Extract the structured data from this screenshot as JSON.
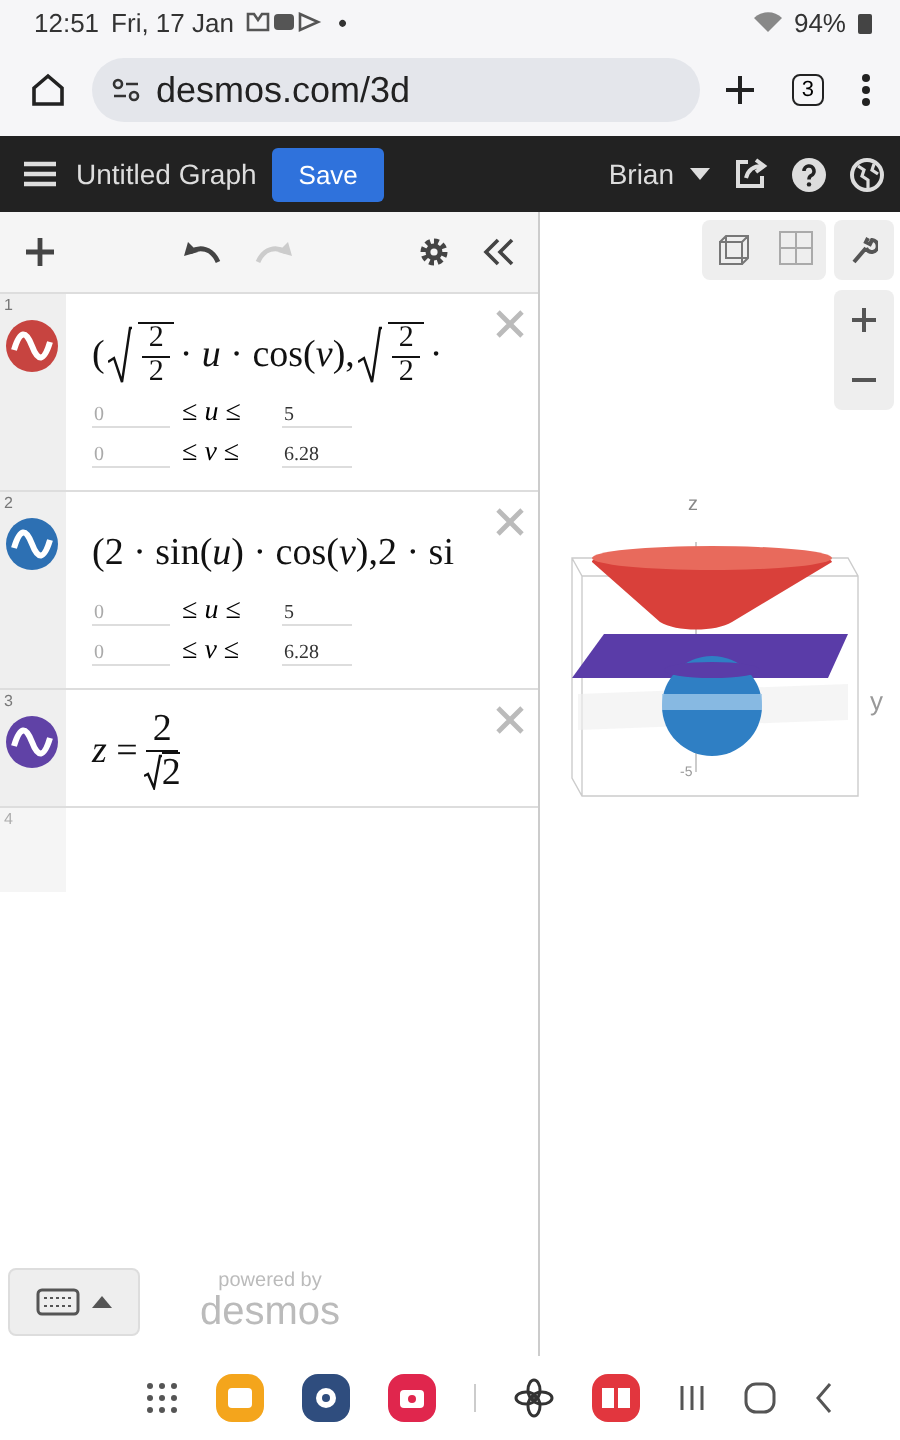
{
  "status_bar": {
    "time": "12:51",
    "date": "Fri, 17 Jan",
    "dot": "•",
    "battery": "94%"
  },
  "browser": {
    "url": "desmos.com/3d",
    "tab_count": "3"
  },
  "header": {
    "title": "Untitled Graph",
    "save": "Save",
    "user": "Brian"
  },
  "expressions": [
    {
      "number": "1",
      "color": "#c74440",
      "parts": [
        {
          "kind": "text",
          "text": "("
        },
        {
          "kind": "sqrtfrac",
          "num": "2",
          "den": "2"
        },
        {
          "kind": "text",
          "text": " · *u* · cos(*v*),"
        },
        {
          "kind": "sqrtfrac",
          "num": "2",
          "den": "2"
        },
        {
          "kind": "text",
          "text": " ·"
        }
      ],
      "domains": [
        {
          "min": "0",
          "label": "≤ *u* ≤",
          "max": "5"
        },
        {
          "min": "0",
          "label": "≤ *v* ≤",
          "max": "6.28"
        }
      ]
    },
    {
      "number": "2",
      "color": "#2d70b3",
      "parts": [
        {
          "kind": "text",
          "text": "(2 · sin(*u*) · cos(*v*),2 · si"
        }
      ],
      "domains": [
        {
          "min": "0",
          "label": "≤ *u* ≤",
          "max": "5"
        },
        {
          "min": "0",
          "label": "≤ *v* ≤",
          "max": "6.28"
        }
      ]
    },
    {
      "number": "3",
      "color": "#6042a6",
      "parts": [
        {
          "kind": "text",
          "text": "*z* = "
        },
        {
          "kind": "fracsqrt",
          "num": "2",
          "den": "2"
        }
      ]
    }
  ],
  "empty_row": {
    "number": "4"
  },
  "graph": {
    "z_label": "z",
    "y_label": "y",
    "tick_label": "-5"
  },
  "footer": {
    "powered": "powered by",
    "brand": "desmos"
  }
}
